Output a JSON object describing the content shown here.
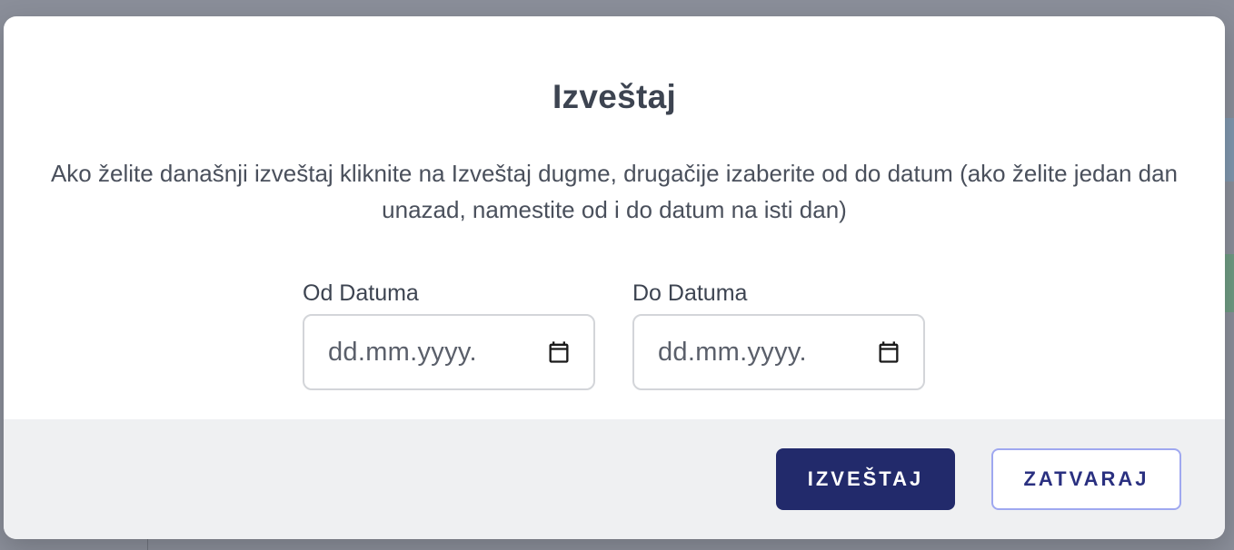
{
  "dialog": {
    "title": "Izveštaj",
    "description": "Ako želite današnji izveštaj kliknite na Izveštaj dugme, drugačije izaberite od do datum (ako želite jedan dan unazad, namestite od i do datum na isti dan)"
  },
  "fields": {
    "from": {
      "label": "Od Datuma",
      "placeholder": "dd.mm.yyyy.",
      "icon": "calendar-icon"
    },
    "to": {
      "label": "Do Datuma",
      "placeholder": "dd.mm.yyyy.",
      "icon": "calendar-icon"
    }
  },
  "footer": {
    "report_button": "IZVEŠTAJ",
    "close_button": "ZATVARAJ"
  },
  "colors": {
    "primary": "#222a6b",
    "secondary_border": "#9fa8f0",
    "footer_bg": "#eff0f2",
    "overlay": "#8a8e99"
  }
}
